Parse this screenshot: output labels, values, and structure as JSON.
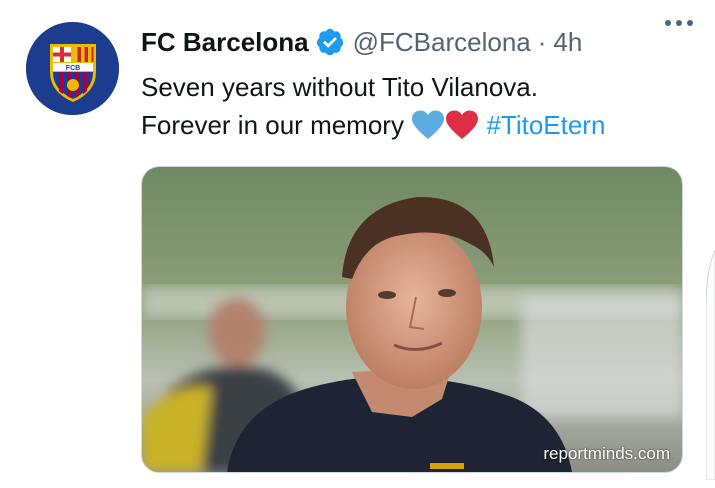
{
  "tweet": {
    "author_name": "FC Barcelona",
    "handle": "@FCBarcelona",
    "separator": "·",
    "time": "4h",
    "text_line1": "Seven years without Tito Vilanova.",
    "text_line2": "Forever in our memory",
    "hashtag": "#TitoEtern",
    "avatar_text": "FCB"
  },
  "media": {
    "watermark": "reportminds.com"
  },
  "icons": {
    "verified": "verified-badge-icon",
    "more": "more-options-icon",
    "blue_heart": "blue-heart-emoji",
    "red_heart": "red-heart-emoji"
  },
  "colors": {
    "link": "#1d9bf0",
    "secondary_text": "#536471",
    "blue_heart": "#5dade2",
    "red_heart": "#dd2e44",
    "crest_blue": "#1c3d8f",
    "crest_garnet": "#a50044",
    "crest_gold": "#edbb00"
  }
}
